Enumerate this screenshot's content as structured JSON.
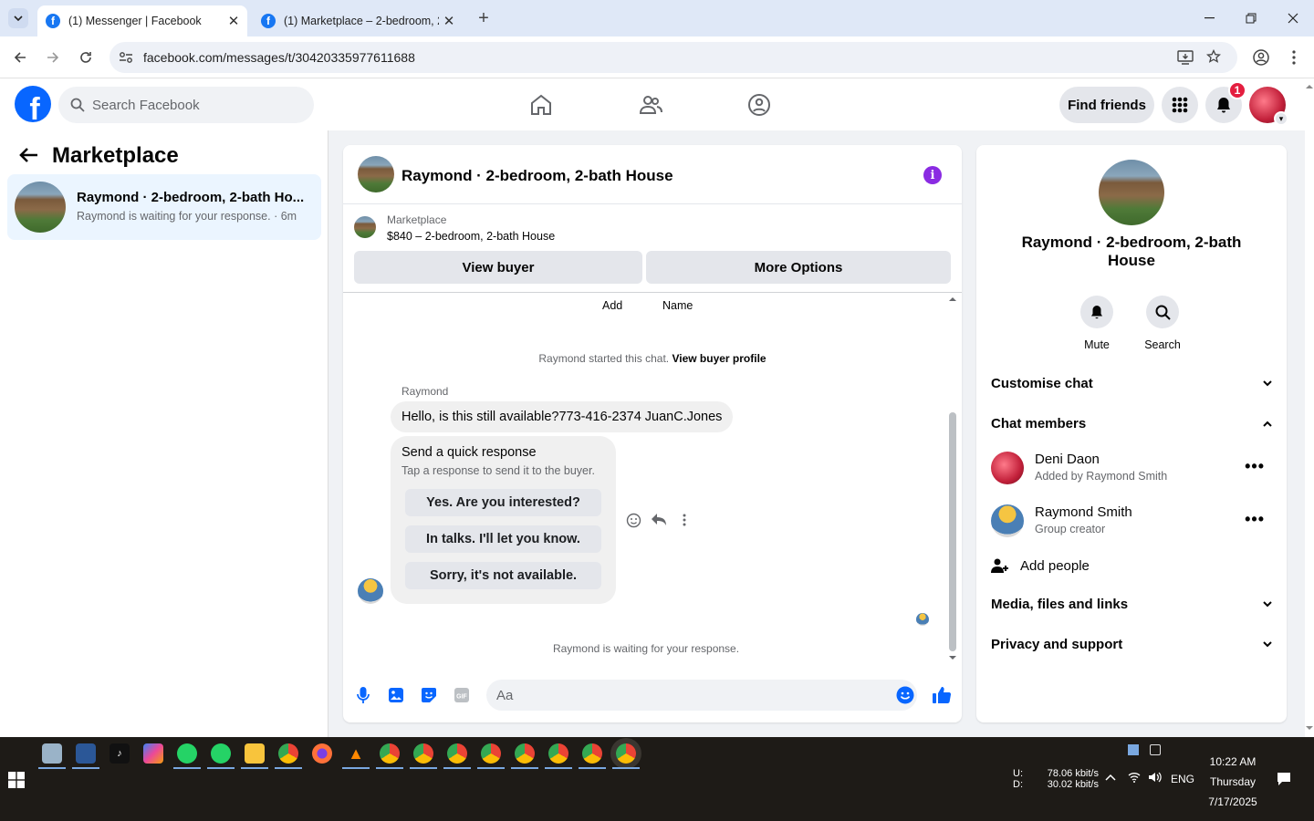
{
  "browser": {
    "tabs": [
      {
        "title": "(1) Messenger | Facebook",
        "active": true
      },
      {
        "title": "(1) Marketplace – 2-bedroom, 2",
        "active": false
      }
    ],
    "url": "facebook.com/messages/t/30420335977611688"
  },
  "header": {
    "search_placeholder": "Search Facebook",
    "find_friends": "Find friends",
    "notification_count": "1"
  },
  "left_panel": {
    "title": "Marketplace",
    "conversation": {
      "name": "Raymond · 2-bedroom, 2-bath Ho...",
      "preview": "Raymond is waiting for your response. · 6m"
    }
  },
  "chat": {
    "title": "Raymond · 2-bedroom, 2-bath House",
    "marketplace_label": "Marketplace",
    "listing": "$840 – 2-bedroom, 2-bath House",
    "view_buyer": "View buyer",
    "more_options": "More Options",
    "top_labels": {
      "add": "Add",
      "name": "Name"
    },
    "started": "Raymond started this chat.",
    "view_profile": "View buyer profile",
    "sender": "Raymond",
    "message": "Hello, is this still available?773-416-2374 JuanC.Jones",
    "quick": {
      "heading": "Send a quick response",
      "sub": "Tap a response to send it to the buyer.",
      "options": [
        "Yes. Are you interested?",
        "In talks. I'll let you know.",
        "Sorry, it's not available."
      ]
    },
    "waiting": "Raymond is waiting for your response.",
    "composer_placeholder": "Aa"
  },
  "right_panel": {
    "name": "Raymond · 2-bedroom, 2-bath House",
    "mute": "Mute",
    "search": "Search",
    "customise": "Customise chat",
    "members_heading": "Chat members",
    "members": [
      {
        "name": "Deni Daon",
        "role": "Added by Raymond Smith"
      },
      {
        "name": "Raymond Smith",
        "role": "Group creator"
      }
    ],
    "add_people": "Add people",
    "media": "Media, files and links",
    "privacy": "Privacy and support"
  },
  "taskbar": {
    "up_label": "U:",
    "down_label": "D:",
    "up_speed": "78.06 kbit/s",
    "down_speed": "30.02 kbit/s",
    "lang": "ENG",
    "time": "10:22 AM",
    "day": "Thursday",
    "date": "7/17/2025"
  },
  "colors": {
    "fb_blue": "#0866ff",
    "notif_red": "#e41e3f",
    "info_purple": "#8a2be2"
  }
}
